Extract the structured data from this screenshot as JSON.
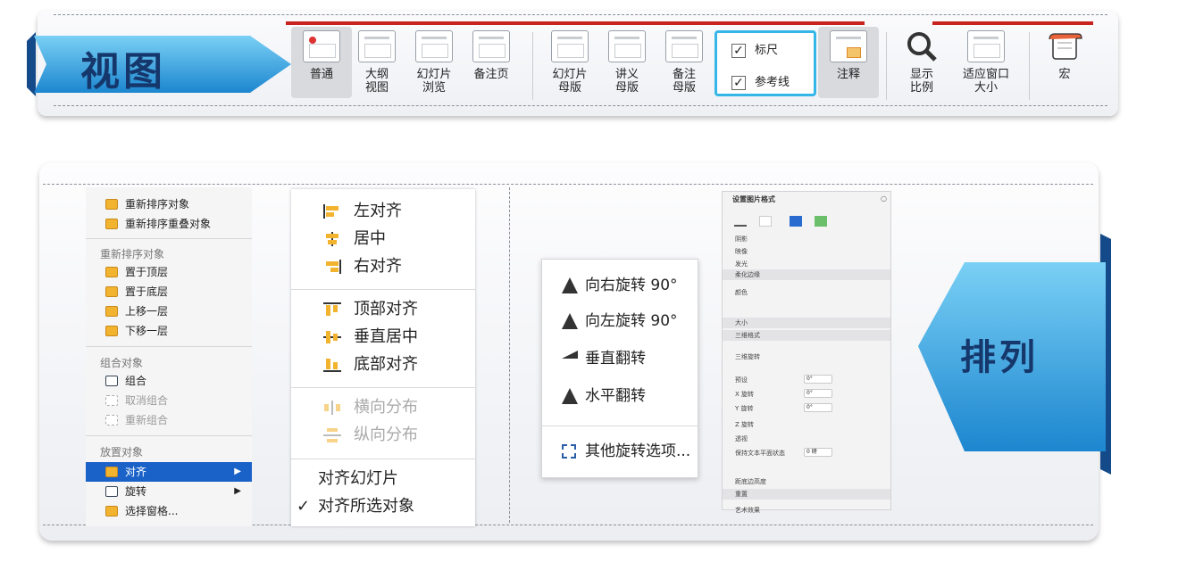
{
  "top": {
    "title": "视图",
    "buttons": [
      "普通",
      "大纲\n视图",
      "幻灯片\n浏览",
      "备注页",
      "幻灯片\n母版",
      "讲义\n母版",
      "备注\n母版",
      "注释",
      "显示\n比例",
      "适应窗口\n大小",
      "宏"
    ],
    "checkboxes": {
      "ruler": "标尺",
      "guides": "参考线",
      "ruler_mark": "✓",
      "guides_mark": "✓"
    }
  },
  "bottom": {
    "title": "排列",
    "context_menu": {
      "items_top": [
        "重新排序对象",
        "重新排序重叠对象"
      ],
      "header_order": "重新排序对象",
      "order_items": [
        "置于顶层",
        "置于底层",
        "上移一层",
        "下移一层"
      ],
      "header_group": "组合对象",
      "group_items": [
        "组合",
        "取消组合",
        "重新组合"
      ],
      "header_place": "放置对象",
      "place_items": [
        "对齐",
        "旋转",
        "选择窗格..."
      ],
      "arrow": "▶"
    },
    "align_menu": {
      "items": [
        "左对齐",
        "居中",
        "右对齐",
        "顶部对齐",
        "垂直居中",
        "底部对齐",
        "横向分布",
        "纵向分布",
        "对齐幻灯片",
        "对齐所选对象"
      ],
      "check": "✓"
    },
    "rotate_menu": {
      "items": [
        "向右旋转 90°",
        "向左旋转 90°",
        "垂直翻转",
        "水平翻转",
        "其他旋转选项..."
      ]
    },
    "format_pane": {
      "title": "设置图片格式",
      "rows": [
        "阴影",
        "映像",
        "发光",
        "柔化边缘",
        "颜色",
        "大小",
        "三维格式",
        "三维旋转",
        "预设",
        "X 旋转",
        "Y 旋转",
        "Z 旋转",
        "透视",
        "保持文本平面状态",
        "距底边高度",
        "重置",
        "艺术效果",
        "艺术效果"
      ],
      "values": [
        "0°",
        "0°",
        "0°",
        "0 磅"
      ]
    }
  },
  "colors": {
    "ribbon_red": "#c8231e",
    "accent_blue": "#1a62c8",
    "banner_dark": "#15376b",
    "highlight": "#36b6e8"
  }
}
